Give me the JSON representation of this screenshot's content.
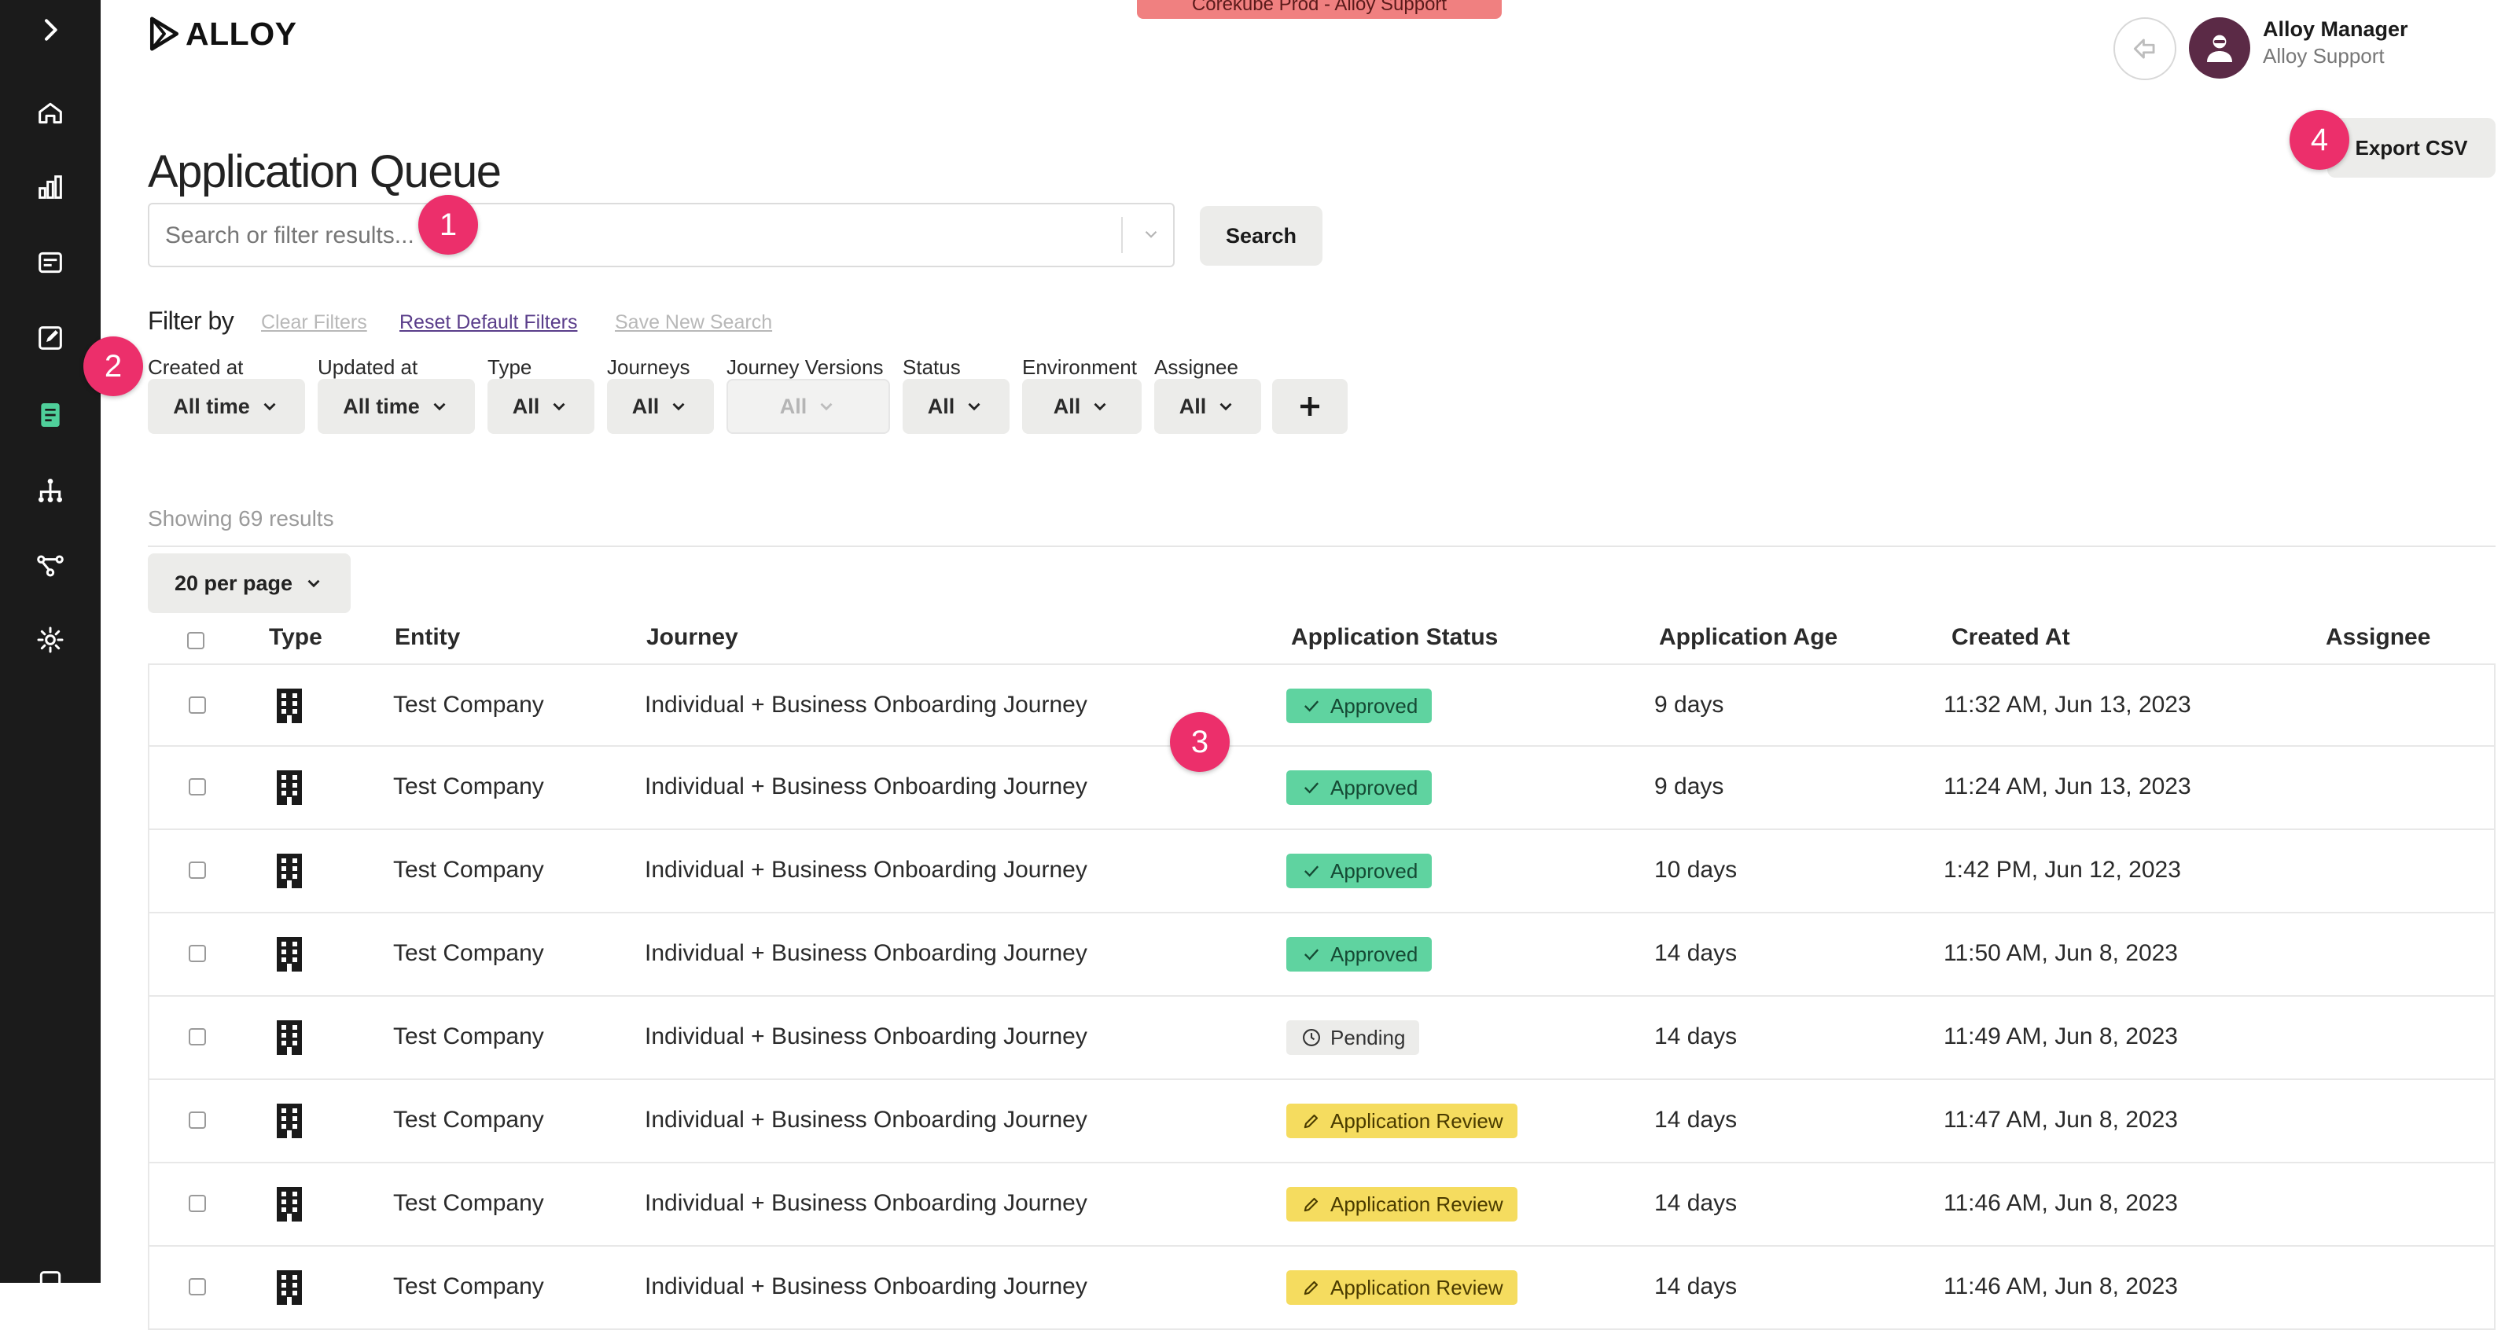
{
  "env_banner": "Corekube Prod - Alloy Support",
  "logo": {
    "text": "ALLOY"
  },
  "user": {
    "name": "Alloy Manager",
    "org": "Alloy Support"
  },
  "page_title": "Application Queue",
  "export_label": "Export CSV",
  "search": {
    "placeholder": "Search or filter results...",
    "value": "",
    "button_label": "Search"
  },
  "filters": {
    "title": "Filter by",
    "clear_label": "Clear Filters",
    "reset_label": "Reset Default Filters",
    "save_label": "Save New Search",
    "items": [
      {
        "label": "Created at",
        "value": "All time"
      },
      {
        "label": "Updated at",
        "value": "All time"
      },
      {
        "label": "Type",
        "value": "All"
      },
      {
        "label": "Journeys",
        "value": "All"
      },
      {
        "label": "Journey Versions",
        "value": "All"
      },
      {
        "label": "Status",
        "value": "All"
      },
      {
        "label": "Environment",
        "value": "All"
      },
      {
        "label": "Assignee",
        "value": "All"
      }
    ]
  },
  "results": {
    "showing_text": "Showing 69 results",
    "per_page": "20 per page"
  },
  "table": {
    "columns": [
      "Type",
      "Entity",
      "Journey",
      "Application Status",
      "Application Age",
      "Created At",
      "Assignee"
    ],
    "rows": [
      {
        "entity": "Test Company",
        "journey": "Individual + Business Onboarding Journey",
        "status": "Approved",
        "age": "9 days",
        "created": "11:32 AM, Jun 13, 2023",
        "assignee": ""
      },
      {
        "entity": "Test Company",
        "journey": "Individual + Business Onboarding Journey",
        "status": "Approved",
        "age": "9 days",
        "created": "11:24 AM, Jun 13, 2023",
        "assignee": ""
      },
      {
        "entity": "Test Company",
        "journey": "Individual + Business Onboarding Journey",
        "status": "Approved",
        "age": "10 days",
        "created": "1:42 PM, Jun 12, 2023",
        "assignee": ""
      },
      {
        "entity": "Test Company",
        "journey": "Individual + Business Onboarding Journey",
        "status": "Approved",
        "age": "14 days",
        "created": "11:50 AM, Jun 8, 2023",
        "assignee": ""
      },
      {
        "entity": "Test Company",
        "journey": "Individual + Business Onboarding Journey",
        "status": "Pending",
        "age": "14 days",
        "created": "11:49 AM, Jun 8, 2023",
        "assignee": ""
      },
      {
        "entity": "Test Company",
        "journey": "Individual + Business Onboarding Journey",
        "status": "Application Review",
        "age": "14 days",
        "created": "11:47 AM, Jun 8, 2023",
        "assignee": ""
      },
      {
        "entity": "Test Company",
        "journey": "Individual + Business Onboarding Journey",
        "status": "Application Review",
        "age": "14 days",
        "created": "11:46 AM, Jun 8, 2023",
        "assignee": ""
      },
      {
        "entity": "Test Company",
        "journey": "Individual + Business Onboarding Journey",
        "status": "Application Review",
        "age": "14 days",
        "created": "11:46 AM, Jun 8, 2023",
        "assignee": ""
      }
    ]
  },
  "annotations": [
    "1",
    "2",
    "3",
    "4"
  ],
  "colors": {
    "rail": "#1b1b1b",
    "approved": "#5fd3a0",
    "review": "#f5dc5f",
    "pending": "#ececea",
    "marker": "#ec2f6b",
    "active_nav": "#4fcf9a"
  }
}
